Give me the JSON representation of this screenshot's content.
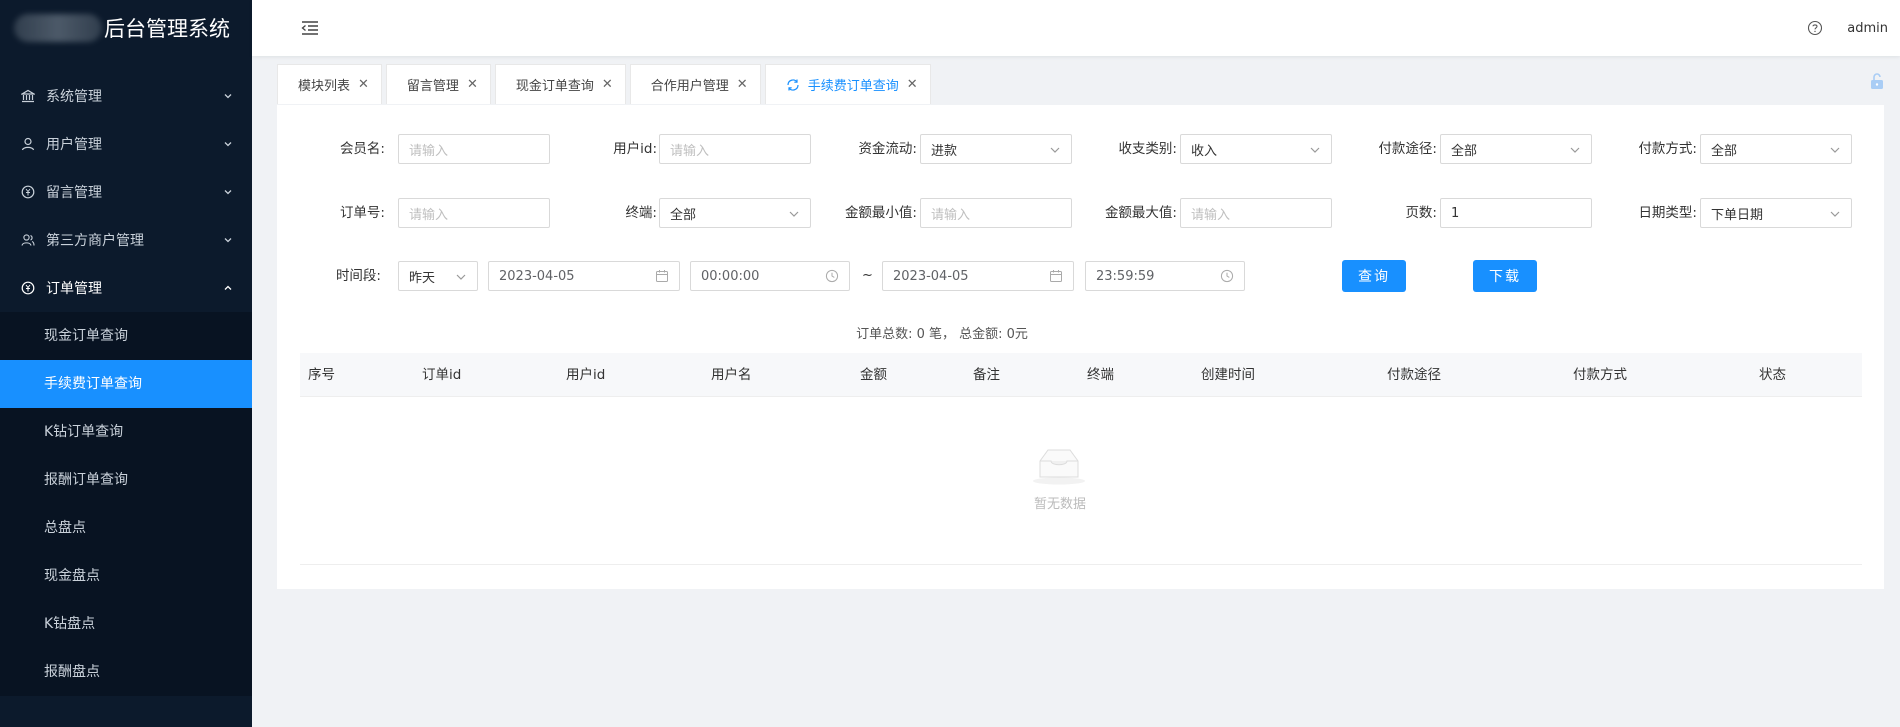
{
  "app": {
    "title": "后台管理系统"
  },
  "header": {
    "user": "admin"
  },
  "sidebar": {
    "items": [
      {
        "label": "系统管理",
        "icon": "bank-icon"
      },
      {
        "label": "用户管理",
        "icon": "user-icon"
      },
      {
        "label": "留言管理",
        "icon": "coin-icon"
      },
      {
        "label": "第三方商户管理",
        "icon": "team-icon"
      },
      {
        "label": "订单管理",
        "icon": "coin-icon"
      }
    ],
    "sub_items": [
      "现金订单查询",
      "手续费订单查询",
      "K钻订单查询",
      "报酬订单查询",
      "总盘点",
      "现金盘点",
      "K钻盘点",
      "报酬盘点"
    ],
    "active_sub": "手续费订单查询"
  },
  "tabs": [
    {
      "label": "模块列表",
      "active": false
    },
    {
      "label": "留言管理",
      "active": false
    },
    {
      "label": "现金订单查询",
      "active": false
    },
    {
      "label": "合作用户管理",
      "active": false
    },
    {
      "label": "手续费订单查询",
      "active": true
    }
  ],
  "form": {
    "member_name": {
      "label": "会员名:",
      "placeholder": "请输入"
    },
    "user_id": {
      "label": "用户id:",
      "placeholder": "请输入"
    },
    "fund_flow": {
      "label": "资金流动:",
      "value": "进款"
    },
    "io_type": {
      "label": "收支类别:",
      "value": "收入"
    },
    "pay_channel": {
      "label": "付款途径:",
      "value": "全部"
    },
    "pay_method": {
      "label": "付款方式:",
      "value": "全部"
    },
    "order_no": {
      "label": "订单号:",
      "placeholder": "请输入"
    },
    "terminal": {
      "label": "终端:",
      "value": "全部"
    },
    "min_amount": {
      "label": "金额最小值:",
      "placeholder": "请输入"
    },
    "max_amount": {
      "label": "金额最大值:",
      "placeholder": "请输入"
    },
    "page": {
      "label": "页数:",
      "value": "1"
    },
    "date_type": {
      "label": "日期类型:",
      "value": "下单日期"
    },
    "time_range": {
      "label": "时间段:",
      "preset": "昨天",
      "start_date": "2023-04-05",
      "start_time": "00:00:00",
      "separator": "~",
      "end_date": "2023-04-05",
      "end_time": "23:59:59"
    },
    "query_button": "查询",
    "download_button": "下载"
  },
  "summary": "订单总数: 0 笔， 总金额: 0元",
  "table": {
    "columns": [
      "序号",
      "订单id",
      "用户id",
      "用户名",
      "金额",
      "备注",
      "终端",
      "创建时间",
      "付款途径",
      "付款方式",
      "状态"
    ],
    "rows": [],
    "empty_text": "暂无数据"
  },
  "colors": {
    "sidebar_bg": "#0c1a2c",
    "accent": "#1890ff"
  }
}
